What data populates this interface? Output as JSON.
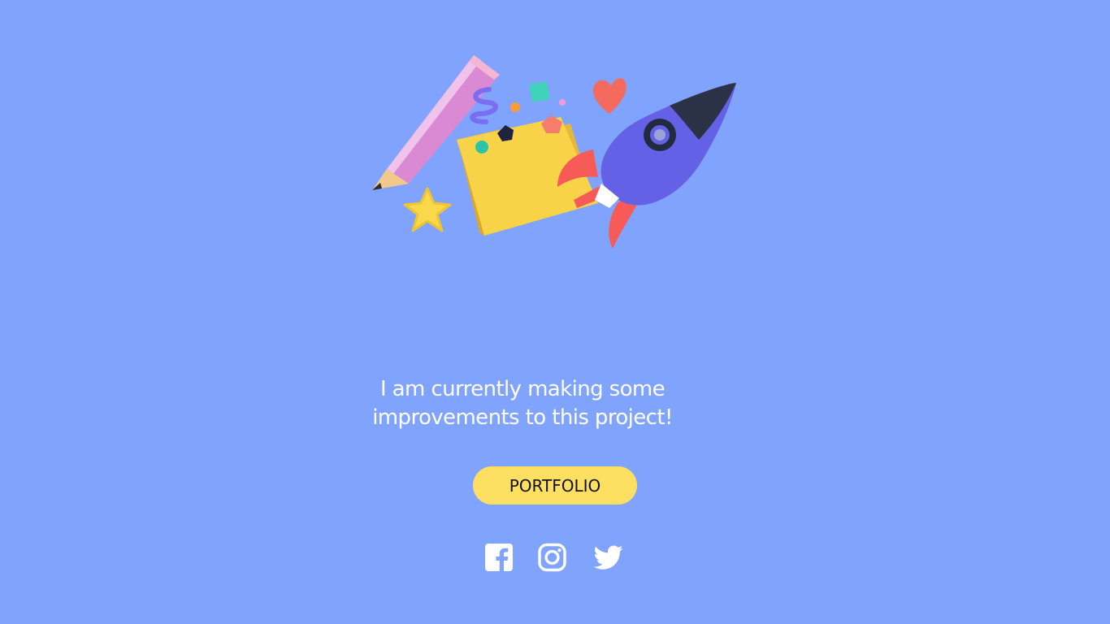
{
  "message": {
    "line1": "I am currently making some",
    "line2": "improvements to this project!"
  },
  "cta": {
    "label": "PORTFOLIO"
  },
  "social": [
    {
      "name": "facebook",
      "icon": "facebook-icon"
    },
    {
      "name": "instagram",
      "icon": "instagram-icon"
    },
    {
      "name": "twitter",
      "icon": "twitter-icon"
    }
  ],
  "illustration": {
    "icons": [
      "pencil-icon",
      "folder-icon",
      "rocket-icon",
      "heart-icon",
      "star-icon"
    ]
  },
  "colors": {
    "background": "#80a3fd",
    "button": "#fddf62",
    "text": "#ffffff"
  }
}
